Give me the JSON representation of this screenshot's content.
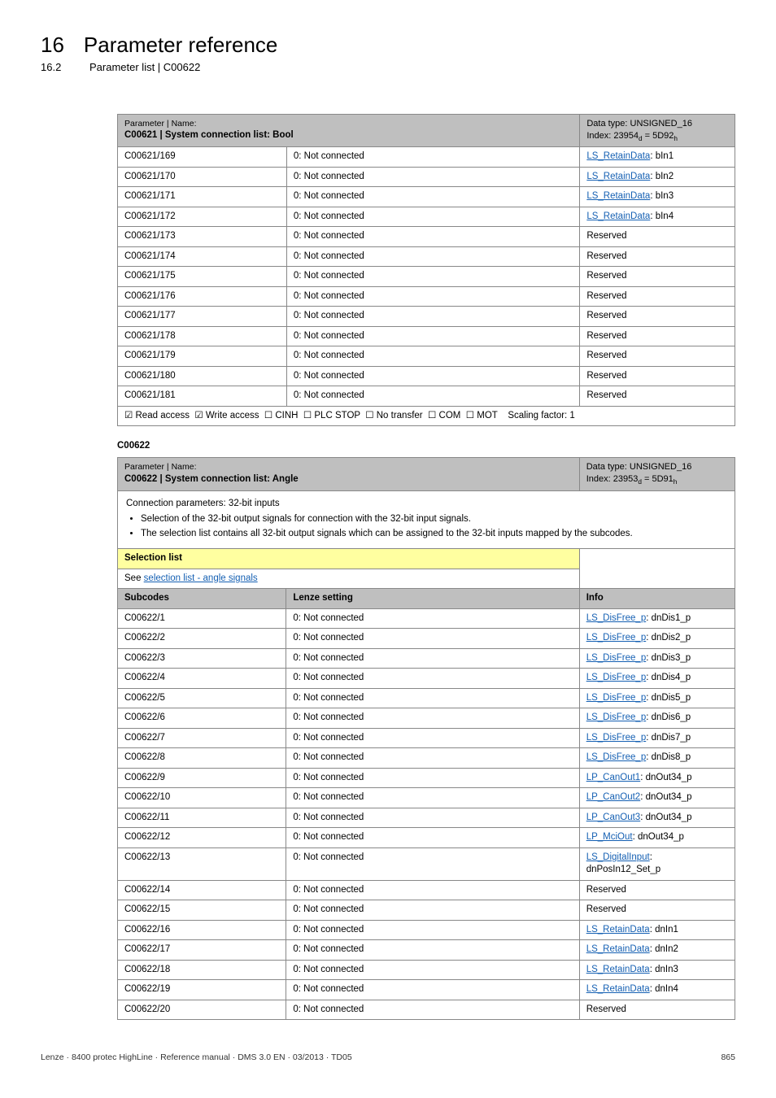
{
  "header": {
    "chapter_num": "16",
    "chapter_title": "Parameter reference",
    "sub_num": "16.2",
    "sub_title": "Parameter list | C00622"
  },
  "table1": {
    "label_paramname": "Parameter | Name:",
    "code_line": "C00621 | System connection list: Bool",
    "datatype_line1": "Data type: UNSIGNED_16",
    "datatype_line2": "Index: 23954",
    "datatype_line2_sub": "d",
    "datatype_line2_eq": " = 5D92",
    "datatype_line2_sub2": "h",
    "rows": [
      {
        "c": "C00621/169",
        "s": "0: Not connected",
        "link": "LS_RetainData",
        "after": ": bIn1"
      },
      {
        "c": "C00621/170",
        "s": "0: Not connected",
        "link": "LS_RetainData",
        "after": ": bIn2"
      },
      {
        "c": "C00621/171",
        "s": "0: Not connected",
        "link": "LS_RetainData",
        "after": ": bIn3"
      },
      {
        "c": "C00621/172",
        "s": "0: Not connected",
        "link": "LS_RetainData",
        "after": ": bIn4"
      },
      {
        "c": "C00621/173",
        "s": "0: Not connected",
        "plain": "Reserved"
      },
      {
        "c": "C00621/174",
        "s": "0: Not connected",
        "plain": "Reserved"
      },
      {
        "c": "C00621/175",
        "s": "0: Not connected",
        "plain": "Reserved"
      },
      {
        "c": "C00621/176",
        "s": "0: Not connected",
        "plain": "Reserved"
      },
      {
        "c": "C00621/177",
        "s": "0: Not connected",
        "plain": "Reserved"
      },
      {
        "c": "C00621/178",
        "s": "0: Not connected",
        "plain": "Reserved"
      },
      {
        "c": "C00621/179",
        "s": "0: Not connected",
        "plain": "Reserved"
      },
      {
        "c": "C00621/180",
        "s": "0: Not connected",
        "plain": "Reserved"
      },
      {
        "c": "C00621/181",
        "s": "0: Not connected",
        "plain": "Reserved"
      }
    ],
    "footer": "☑ Read access  ☑ Write access  ☐ CINH  ☐ PLC STOP  ☐ No transfer  ☐ COM  ☐ MOT    Scaling factor: 1"
  },
  "between_label": "C00622",
  "table2": {
    "label_paramname": "Parameter | Name:",
    "code_line": "C00622 | System connection list: Angle",
    "datatype_line1": "Data type: UNSIGNED_16",
    "datatype_line2": "Index: 23953",
    "datatype_line2_sub": "d",
    "datatype_line2_eq": " = 5D91",
    "datatype_line2_sub2": "h",
    "desc_title": "Connection parameters: 32-bit inputs",
    "desc_b1": "Selection of the 32-bit output signals for connection with the 32-bit input signals.",
    "desc_b2": "The selection list contains all 32-bit output signals which can be assigned to the 32-bit inputs mapped by the subcodes.",
    "selection_label": "Selection list",
    "selection_link_prefix": "See ",
    "selection_link_text": "selection list - angle signals",
    "subcodes_h1": "Subcodes",
    "subcodes_h2": "Lenze setting",
    "subcodes_h3": "Info",
    "rows": [
      {
        "c": "C00622/1",
        "s": "0: Not connected",
        "link": "LS_DisFree_p",
        "after": ": dnDis1_p"
      },
      {
        "c": "C00622/2",
        "s": "0: Not connected",
        "link": "LS_DisFree_p",
        "after": ": dnDis2_p"
      },
      {
        "c": "C00622/3",
        "s": "0: Not connected",
        "link": "LS_DisFree_p",
        "after": ": dnDis3_p"
      },
      {
        "c": "C00622/4",
        "s": "0: Not connected",
        "link": "LS_DisFree_p",
        "after": ": dnDis4_p"
      },
      {
        "c": "C00622/5",
        "s": "0: Not connected",
        "link": "LS_DisFree_p",
        "after": ": dnDis5_p"
      },
      {
        "c": "C00622/6",
        "s": "0: Not connected",
        "link": "LS_DisFree_p",
        "after": ": dnDis6_p"
      },
      {
        "c": "C00622/7",
        "s": "0: Not connected",
        "link": "LS_DisFree_p",
        "after": ": dnDis7_p"
      },
      {
        "c": "C00622/8",
        "s": "0: Not connected",
        "link": "LS_DisFree_p",
        "after": ": dnDis8_p"
      },
      {
        "c": "C00622/9",
        "s": "0: Not connected",
        "link": "LP_CanOut1",
        "after": ": dnOut34_p"
      },
      {
        "c": "C00622/10",
        "s": "0: Not connected",
        "link": "LP_CanOut2",
        "after": ": dnOut34_p"
      },
      {
        "c": "C00622/11",
        "s": "0: Not connected",
        "link": "LP_CanOut3",
        "after": ": dnOut34_p"
      },
      {
        "c": "C00622/12",
        "s": "0: Not connected",
        "link": "LP_MciOut",
        "after": ": dnOut34_p"
      },
      {
        "c": "C00622/13",
        "s": "0: Not connected",
        "link": "LS_DigitalInput",
        "after": ": dnPosIn12_Set_p"
      },
      {
        "c": "C00622/14",
        "s": "0: Not connected",
        "plain": "Reserved"
      },
      {
        "c": "C00622/15",
        "s": "0: Not connected",
        "plain": "Reserved"
      },
      {
        "c": "C00622/16",
        "s": "0: Not connected",
        "link": "LS_RetainData",
        "after": ": dnIn1"
      },
      {
        "c": "C00622/17",
        "s": "0: Not connected",
        "link": "LS_RetainData",
        "after": ": dnIn2"
      },
      {
        "c": "C00622/18",
        "s": "0: Not connected",
        "link": "LS_RetainData",
        "after": ": dnIn3"
      },
      {
        "c": "C00622/19",
        "s": "0: Not connected",
        "link": "LS_RetainData",
        "after": ": dnIn4"
      },
      {
        "c": "C00622/20",
        "s": "0: Not connected",
        "plain": "Reserved"
      }
    ]
  },
  "footer": {
    "left": "Lenze · 8400 protec HighLine · Reference manual · DMS 3.0 EN · 03/2013 · TD05",
    "right": "865"
  }
}
